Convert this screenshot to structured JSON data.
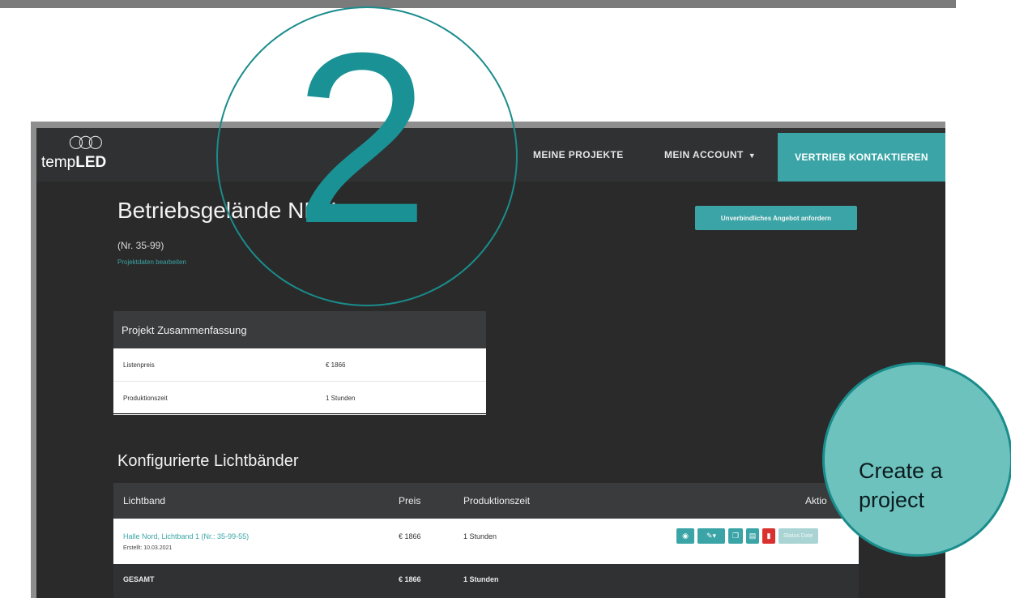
{
  "step_number": "2",
  "callout": {
    "line1": "Create a",
    "line2": "project"
  },
  "nav": {
    "logo_prefix": "temp",
    "logo_suffix": "LED",
    "links": {
      "projects": "MEINE PROJEKTE",
      "account": "MEIN ACCOUNT",
      "contact": "VERTRIEB KONTAKTIEREN"
    }
  },
  "project": {
    "title": "Betriebsgelände NRV",
    "number": "(Nr. 35-99)",
    "edit_link": "Projektdaten bearbeiten",
    "offer_button": "Unverbindliches Angebot anfordern"
  },
  "summary": {
    "title": "Projekt Zusammenfassung",
    "rows": [
      {
        "label": "Listenpreis",
        "value": "€ 1866"
      },
      {
        "label": "Produktionszeit",
        "value": "1 Stunden"
      }
    ]
  },
  "lichtbaender": {
    "title": "Konfigurierte Lichtbänder",
    "headers": {
      "name": "Lichtband",
      "price": "Preis",
      "time": "Produktionszeit",
      "actions": "Aktio"
    },
    "row": {
      "name": "Halle Nord, Lichtband 1 (Nr.: 35-99-55)",
      "created": "Erstellt: 10.03.2021",
      "price": "€ 1866",
      "time": "1 Stunden",
      "status_button": "Status Date"
    },
    "total": {
      "label": "GESAMT",
      "price": "€ 1866",
      "time": "1 Stunden"
    }
  }
}
